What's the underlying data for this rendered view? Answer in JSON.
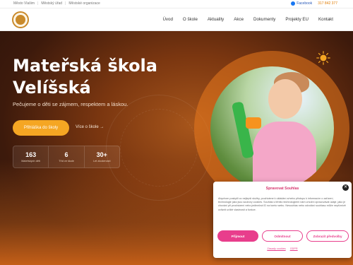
{
  "topbar": {
    "links": [
      "Město Vlašim",
      "Městský úřad",
      "Městské organizace"
    ],
    "facebook": "Facebook",
    "phone": "317 842 377"
  },
  "nav": {
    "items": [
      "Úvod",
      "O škole",
      "Aktuality",
      "Akce",
      "Dokumenty",
      "Projekty EU",
      "Kontakt"
    ]
  },
  "hero": {
    "title_line1": "Mateřská škola",
    "title_line2": "Velíšská",
    "subtitle": "Pečujeme o děti se zájmem, respektem a láskou.",
    "cta_primary": "Přihláška do školy",
    "cta_link": "Více o škole →",
    "stats": [
      {
        "value": "163",
        "label": "Mateřských dětí"
      },
      {
        "value": "6",
        "label": "Tříd ve škole"
      },
      {
        "value": "30+",
        "label": "Let zkušeností"
      }
    ]
  },
  "cookie": {
    "title": "Spravovat Souhlas",
    "close": "✕",
    "text": "Abychom poskytli co nejlepší služby, používáme k ukládání a/nebo přístupu k informacím o zařízení, technologie jako jsou soubory cookies. Souhlas s těmito technologiemi nám umožní zpracovávat údaje, jako je chování při procházení nebo jedinečná ID na tomto webu. Nesouhlas nebo odvolání souhlasu může nepříznivě ovlivnit určité vlastnosti a funkce.",
    "accept": "Přijmout",
    "reject": "Odmítnout",
    "prefs": "Zobrazit předvolby",
    "links": [
      "Zásady cookies",
      "GDPR"
    ]
  },
  "colors": {
    "accent": "#f5a623",
    "cookie_accent": "#e83e8c",
    "hero_dark": "#2b130a"
  }
}
